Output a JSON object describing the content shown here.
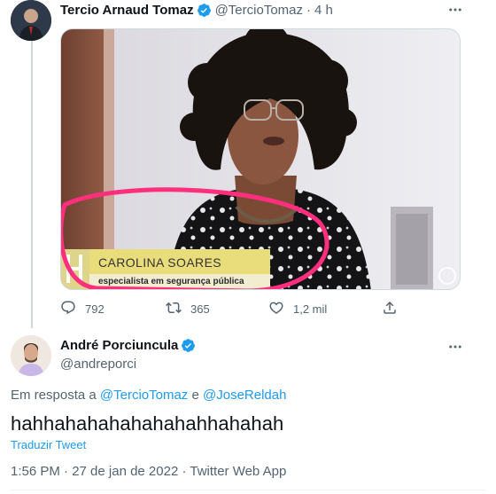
{
  "tweet1": {
    "name": "Tercio Arnaud Tomaz",
    "handle": "@TercioTomaz",
    "separator": "·",
    "time": "4 h",
    "media": {
      "lower_third_name": "CAROLINA SOARES",
      "lower_third_title": "especialista em segurança pública",
      "channel_logo": "GNews"
    },
    "actions": {
      "replies": "792",
      "retweets": "365",
      "likes": "1,2 mil"
    }
  },
  "tweet2": {
    "name": "André Porciuncula",
    "handle": "@andreporci",
    "reply_prefix": "Em resposta a",
    "reply_user1": "@TercioTomaz",
    "reply_conj": "e",
    "reply_user2": "@JoseReldah",
    "text": "hahhahahahahahahahhahahah",
    "translate": "Traduzir Tweet",
    "timestamp": "1:56 PM · 27 de jan de 2022 · Twitter Web App"
  },
  "colors": {
    "accent": "#1d9bf0",
    "secondary_text": "#536471",
    "primary_text": "#0f1419",
    "highlight_circle": "#ff2f7d"
  },
  "icons": [
    "verified-badge-icon",
    "more-icon",
    "reply-icon",
    "retweet-icon",
    "like-icon",
    "share-icon"
  ]
}
